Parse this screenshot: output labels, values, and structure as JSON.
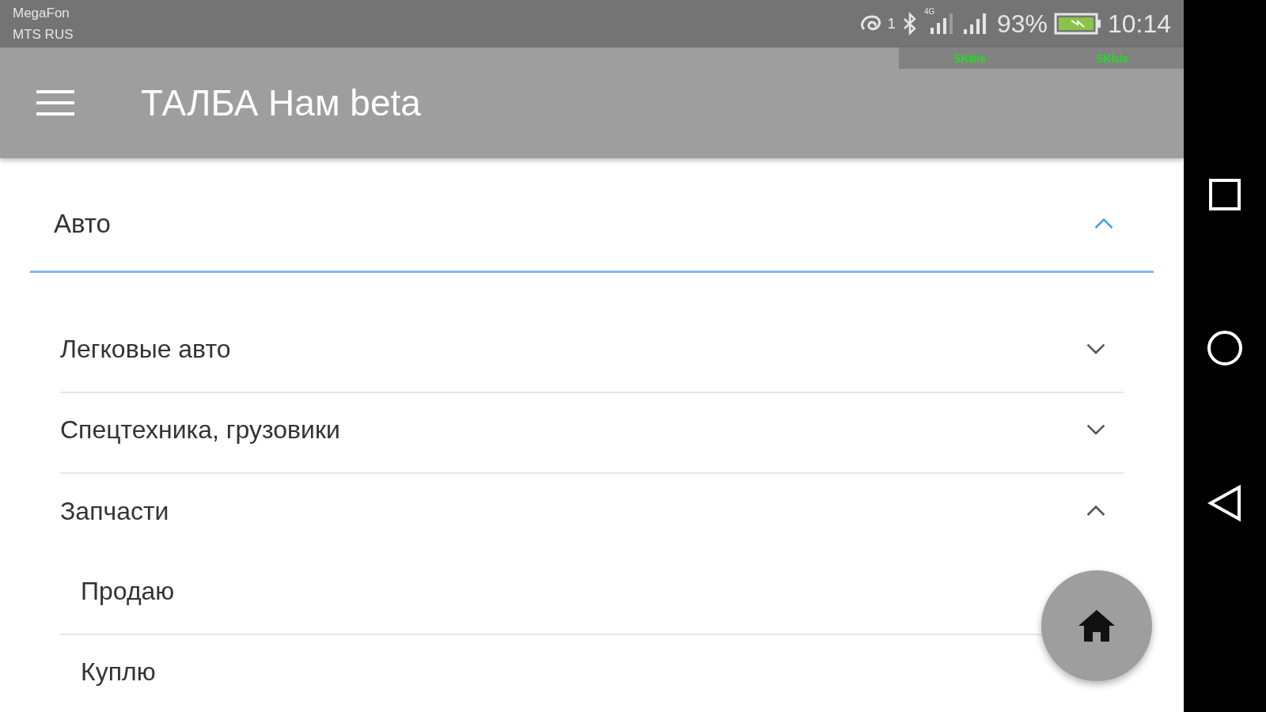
{
  "status_bar": {
    "carriers": [
      "MegaFon",
      "MTS RUS"
    ],
    "notification_count": "1",
    "network": "4G",
    "battery": "93%",
    "time": "10:14",
    "speeds": [
      "5Kb/s",
      "5Kb/s"
    ]
  },
  "app_bar": {
    "title": "ТАЛБА Нам beta"
  },
  "category": {
    "label": "Авто",
    "expanded": true
  },
  "items": [
    {
      "label": "Легковые авто",
      "expanded": false
    },
    {
      "label": "Спецтехника, грузовики",
      "expanded": false
    },
    {
      "label": "Запчасти",
      "expanded": true,
      "children": [
        {
          "label": "Продаю"
        },
        {
          "label": "Куплю"
        }
      ]
    }
  ]
}
